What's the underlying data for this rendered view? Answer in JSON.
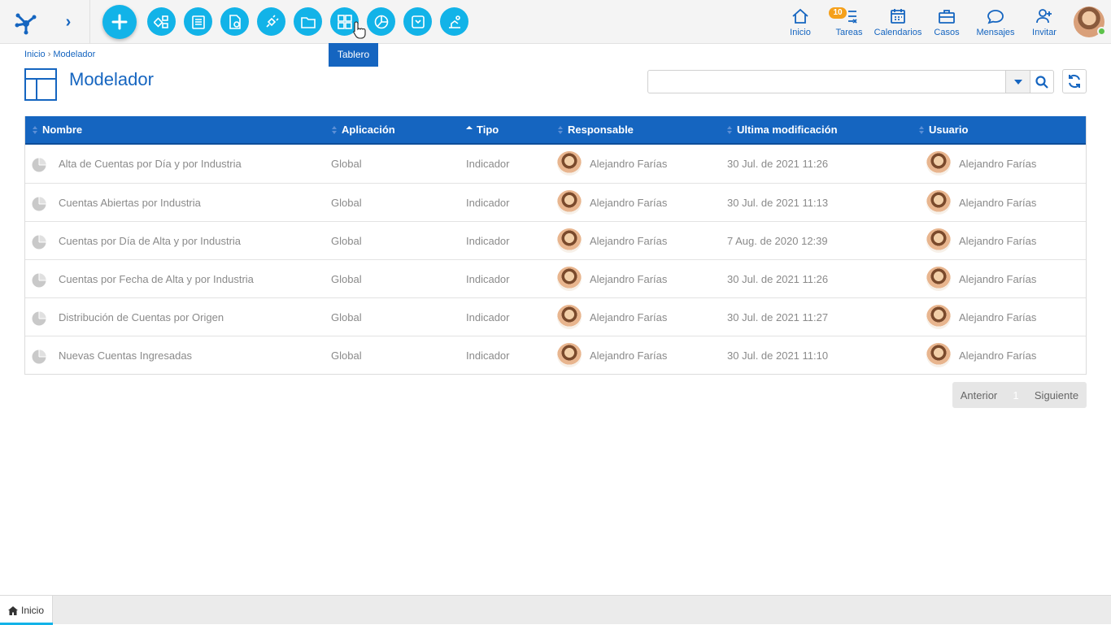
{
  "topbar": {
    "tooltip": "Tablero",
    "tools": [
      {
        "name": "new-button",
        "icon": "plus-icon"
      },
      {
        "name": "processes-button",
        "icon": "process-icon"
      },
      {
        "name": "forms-button",
        "icon": "form-icon"
      },
      {
        "name": "documents-button",
        "icon": "document-gear-icon"
      },
      {
        "name": "integration-button",
        "icon": "plug-icon"
      },
      {
        "name": "folders-button",
        "icon": "folder-icon"
      },
      {
        "name": "dashboard-button",
        "icon": "grid-icon"
      },
      {
        "name": "indicators-button",
        "icon": "pie-chart-icon"
      },
      {
        "name": "archive-button",
        "icon": "archive-icon"
      },
      {
        "name": "modeler-button",
        "icon": "robot-icon"
      }
    ],
    "nav": {
      "home": "Inicio",
      "tasks": "Tareas",
      "tasks_badge": "10",
      "calendars": "Calendarios",
      "cases": "Casos",
      "messages": "Mensajes",
      "invite": "Invitar"
    },
    "accent": "#12b3e8",
    "brand": "#1565c0"
  },
  "breadcrumb": {
    "home": "Inicio",
    "separator": "›",
    "current": "Modelador"
  },
  "page": {
    "title": "Modelador"
  },
  "search": {
    "value": "",
    "placeholder": ""
  },
  "table": {
    "columns": [
      "Nombre",
      "Aplicación",
      "Tipo",
      "Responsable",
      "Ultima modificación",
      "Usuario"
    ],
    "sorted_column": "Tipo",
    "rows": [
      {
        "nombre": "Alta de Cuentas por Día y por Industria",
        "aplicacion": "Global",
        "tipo": "Indicador",
        "responsable": "Alejandro Farías",
        "modificacion": "30 Jul. de 2021 11:26",
        "usuario": "Alejandro Farías"
      },
      {
        "nombre": "Cuentas Abiertas por Industria",
        "aplicacion": "Global",
        "tipo": "Indicador",
        "responsable": "Alejandro Farías",
        "modificacion": "30 Jul. de 2021 11:13",
        "usuario": "Alejandro Farías"
      },
      {
        "nombre": "Cuentas por Día de Alta y por Industria",
        "aplicacion": "Global",
        "tipo": "Indicador",
        "responsable": "Alejandro Farías",
        "modificacion": "7 Aug. de 2020 12:39",
        "usuario": "Alejandro Farías"
      },
      {
        "nombre": "Cuentas por Fecha de Alta y por Industria",
        "aplicacion": "Global",
        "tipo": "Indicador",
        "responsable": "Alejandro Farías",
        "modificacion": "30 Jul. de 2021 11:26",
        "usuario": "Alejandro Farías"
      },
      {
        "nombre": "Distribución de Cuentas por Origen",
        "aplicacion": "Global",
        "tipo": "Indicador",
        "responsable": "Alejandro Farías",
        "modificacion": "30 Jul. de 2021 11:27",
        "usuario": "Alejandro Farías"
      },
      {
        "nombre": "Nuevas Cuentas Ingresadas",
        "aplicacion": "Global",
        "tipo": "Indicador",
        "responsable": "Alejandro Farías",
        "modificacion": "30 Jul. de 2021 11:10",
        "usuario": "Alejandro Farías"
      }
    ]
  },
  "pager": {
    "prev": "Anterior",
    "page": "1",
    "next": "Siguiente"
  },
  "bottom_tab": {
    "label": "Inicio"
  }
}
